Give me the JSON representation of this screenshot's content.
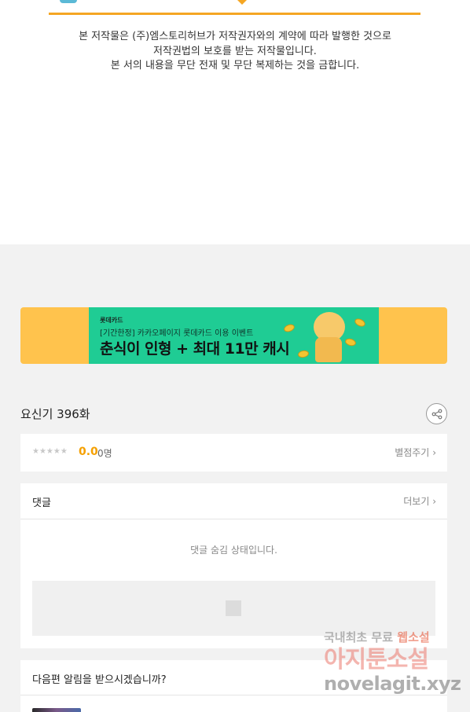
{
  "copyright": {
    "lines": [
      "본 저작물은 (주)엠스토리허브가 저작권자와의 계약에 따라 발행한 것으로",
      "저작권법의 보호를 받는 저작물입니다.",
      "본 서의 내용을 무단 전재 및 무단 복제하는 것을 금합니다."
    ]
  },
  "banner": {
    "brand": "롯데카드",
    "subtitle": "[기간한정] 카카오페이지 롯데카드 이용 이벤트",
    "title": "춘식이 인형 + 최대 11만 캐시",
    "bg_color": "#ffc34d",
    "inner_color": "#1fcc94"
  },
  "episode": {
    "title": "요신기 396화",
    "share_icon": "share-icon"
  },
  "rating": {
    "stars": "★★★★★",
    "score": "0.0",
    "count": "0명",
    "rate_link": "별점주기",
    "score_color": "#f5a000"
  },
  "comments": {
    "title": "댓글",
    "more": "더보기",
    "hidden_text": "댓글 숨김 상태입니다."
  },
  "notify": {
    "question": "다음편 알림을 받으시겠습니까?"
  },
  "watermark": {
    "line1_a": "국내최초 무료",
    "line1_b": "웹소설",
    "line2": "아지툰소설",
    "line3": "novelagit.xyz"
  }
}
